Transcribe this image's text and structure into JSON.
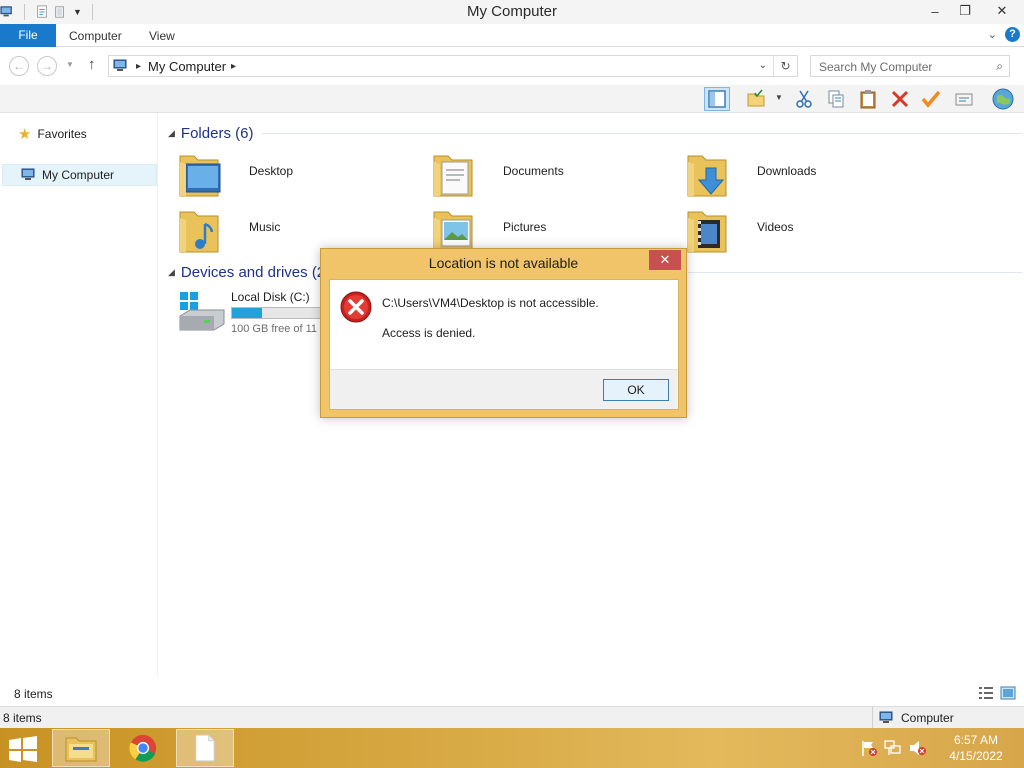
{
  "window": {
    "title": "My Computer",
    "minimize_glyph": "–",
    "maximize_glyph": "❐",
    "close_glyph": "✕"
  },
  "ribbon": {
    "tabs": [
      {
        "label": "File"
      },
      {
        "label": "Computer"
      },
      {
        "label": "View"
      }
    ]
  },
  "address": {
    "path_label": "My Computer",
    "search_placeholder": "Search My Computer"
  },
  "navigation": {
    "items": [
      {
        "label": "Favorites",
        "icon": "star-icon"
      },
      {
        "label": "My Computer",
        "icon": "computer-icon",
        "selected": true
      }
    ]
  },
  "content": {
    "folders_header": "Folders (6)",
    "folders": [
      {
        "label": "Desktop",
        "icon": "desktop-folder-icon"
      },
      {
        "label": "Documents",
        "icon": "documents-folder-icon"
      },
      {
        "label": "Downloads",
        "icon": "downloads-folder-icon"
      },
      {
        "label": "Music",
        "icon": "music-folder-icon"
      },
      {
        "label": "Pictures",
        "icon": "pictures-folder-icon"
      },
      {
        "label": "Videos",
        "icon": "videos-folder-icon"
      }
    ],
    "devices_header": "Devices and drives (2",
    "drive": {
      "label": "Local Disk (C:)",
      "free_text": "100 GB free of 11",
      "used_fraction": 0.28
    }
  },
  "dialog": {
    "title": "Location is not available",
    "close_glyph": "✕",
    "message_line1": "C:\\Users\\VM4\\Desktop is not accessible.",
    "message_line2": "Access is denied.",
    "ok_label": "OK"
  },
  "status": {
    "item_count": "8 items",
    "detail_item_count": "8 items",
    "zone_label": "Computer"
  },
  "taskbar": {
    "time": "6:57 AM",
    "date": "4/15/2022"
  },
  "colors": {
    "accent": "#1979ca",
    "group_header": "#1e3287",
    "dialog_frame": "#f2c46a",
    "taskbar": "#d8aa45",
    "drive_fill": "#26a0da"
  }
}
